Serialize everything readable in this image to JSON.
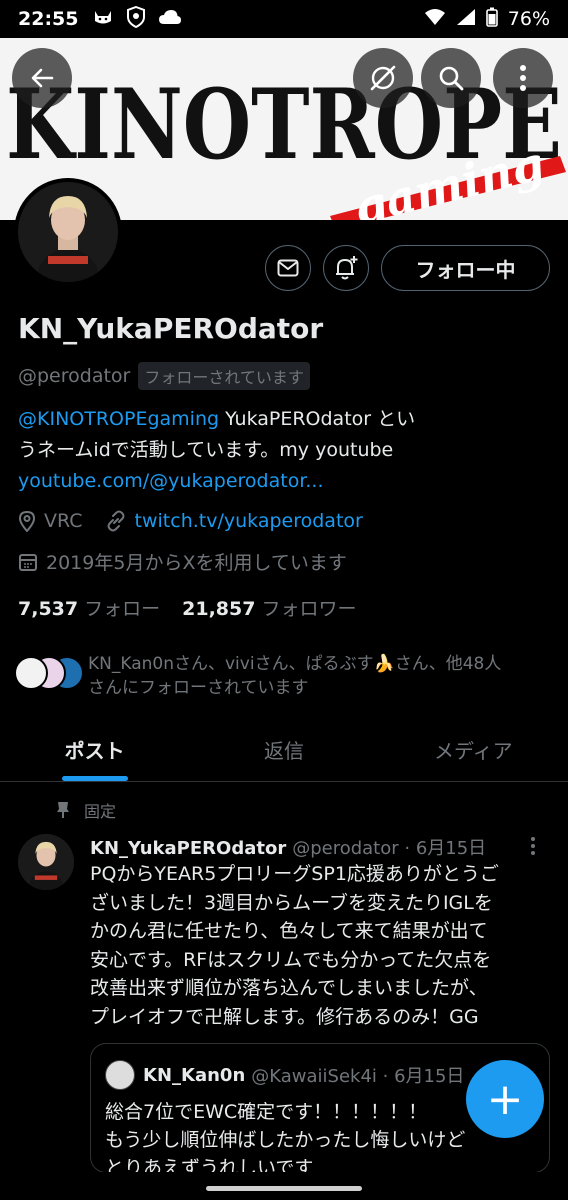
{
  "status_bar": {
    "time": "22:55",
    "battery": "76%",
    "icons": [
      "cat-icon",
      "shield-icon",
      "cloud-icon",
      "wifi-icon",
      "signal-icon",
      "battery-icon"
    ]
  },
  "banner": {
    "logo_text": "KINOTROPE",
    "logo_subtext": "gaming"
  },
  "header_buttons": [
    "back-arrow-icon",
    "grok-icon",
    "search-icon",
    "more-icon"
  ],
  "profile": {
    "follow_button": "フォロー中",
    "display_name": "KN_YukaPEROdator",
    "handle": "@perodator",
    "follows_you": "フォローされています",
    "bio_mention": "@KINOTROPEgaming",
    "bio_text_1": " YukaPEROdator とい",
    "bio_text_2": "うネームidで活動しています。my youtube",
    "bio_link": "youtube.com/@yukaperodator...",
    "location": "VRC",
    "website": "twitch.tv/yukaperodator",
    "joined": "2019年5月からXを利用しています",
    "following_count": "7,537",
    "following_label": "フォロー",
    "followers_count": "21,857",
    "followers_label": "フォロワー",
    "followed_by_1": "KN_Kan0nさん、viviさん、ぱるぶす🍌さん、他48人",
    "followed_by_2": "さんにフォローされています"
  },
  "tabs": [
    "ポスト",
    "返信",
    "メディア"
  ],
  "pinned_label": "固定",
  "post": {
    "name": "KN_YukaPEROdator",
    "handle_date": "@perodator · 6月15日",
    "lines": [
      "PQからYEAR5プロリーグSP1応援ありがとうご",
      "ざいました！3週目からムーブを変えたりIGLを",
      "かのん君に任せたり、色々して来て結果が出て",
      "安心です。RFはスクリムでも分かってた欠点を",
      "改善出来ず順位が落ち込んでしまいましたが、",
      "プレイオフで卍解します。修行あるのみ！GG"
    ]
  },
  "quote": {
    "name": "KN_Kan0n",
    "handle_date": "@KawaiiSek4i · 6月15日",
    "lines": [
      "総合7位でEWC確定です！！！！！！",
      "もう少し順位伸ばしたかったし悔しいけど",
      "とりあえずうれしいです"
    ]
  },
  "fab_label": "+"
}
